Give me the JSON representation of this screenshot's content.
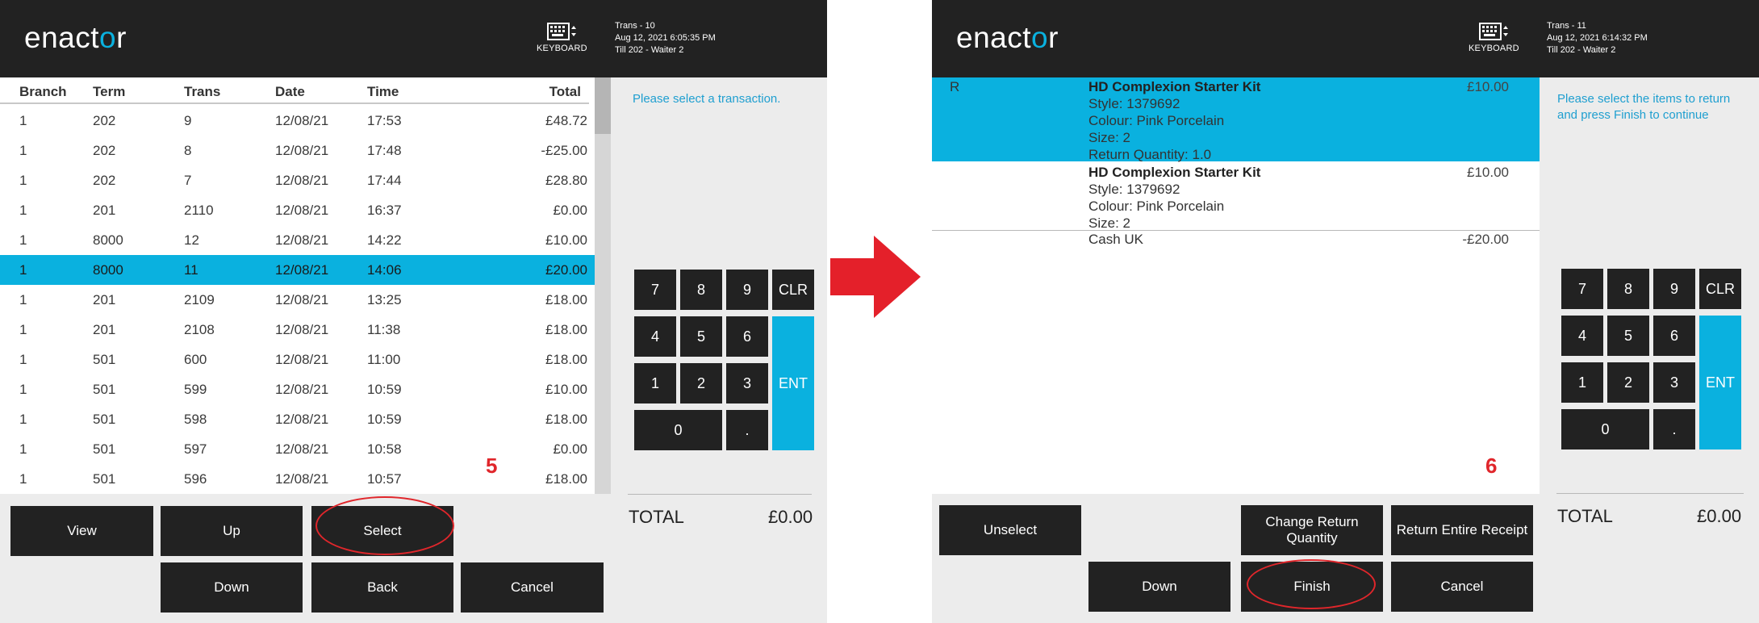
{
  "left": {
    "logo": {
      "pre": "enact",
      "o": "o",
      "post": "r"
    },
    "keyboard_label": "KEYBOARD",
    "info": [
      "Trans - 10",
      "Aug 12, 2021 6:05:35 PM",
      "Till 202 - Waiter 2"
    ],
    "columns": [
      "Branch",
      "Term",
      "Trans",
      "Date",
      "Time",
      "Total"
    ],
    "rows": [
      [
        "1",
        "202",
        "9",
        "12/08/21",
        "17:53",
        "£48.72"
      ],
      [
        "1",
        "202",
        "8",
        "12/08/21",
        "17:48",
        "-£25.00"
      ],
      [
        "1",
        "202",
        "7",
        "12/08/21",
        "17:44",
        "£28.80"
      ],
      [
        "1",
        "201",
        "2110",
        "12/08/21",
        "16:37",
        "£0.00"
      ],
      [
        "1",
        "8000",
        "12",
        "12/08/21",
        "14:22",
        "£10.00"
      ],
      [
        "1",
        "8000",
        "11",
        "12/08/21",
        "14:06",
        "£20.00"
      ],
      [
        "1",
        "201",
        "2109",
        "12/08/21",
        "13:25",
        "£18.00"
      ],
      [
        "1",
        "201",
        "2108",
        "12/08/21",
        "11:38",
        "£18.00"
      ],
      [
        "1",
        "501",
        "600",
        "12/08/21",
        "11:00",
        "£18.00"
      ],
      [
        "1",
        "501",
        "599",
        "12/08/21",
        "10:59",
        "£10.00"
      ],
      [
        "1",
        "501",
        "598",
        "12/08/21",
        "10:59",
        "£18.00"
      ],
      [
        "1",
        "501",
        "597",
        "12/08/21",
        "10:58",
        "£0.00"
      ],
      [
        "1",
        "501",
        "596",
        "12/08/21",
        "10:57",
        "£18.00"
      ]
    ],
    "selected_row": 5,
    "prompt": "Please select a transaction.",
    "step_number": "5",
    "buttons": {
      "view": "View",
      "up": "Up",
      "select": "Select",
      "down": "Down",
      "back": "Back",
      "cancel": "Cancel"
    },
    "total_label": "TOTAL",
    "total_value": "£0.00"
  },
  "right": {
    "logo": {
      "pre": "enact",
      "o": "o",
      "post": "r"
    },
    "keyboard_label": "KEYBOARD",
    "info": [
      "Trans - 11",
      "Aug 12, 2021 6:14:32 PM",
      "Till 202 - Waiter 2"
    ],
    "items": [
      {
        "flag": "R",
        "name": "HD Complexion Starter Kit",
        "price": "£10.00",
        "details": [
          "Style: 1379692",
          "Colour: Pink Porcelain",
          "Size: 2",
          "Return Quantity: 1.0"
        ]
      },
      {
        "flag": "",
        "name": "HD Complexion Starter Kit",
        "price": "£10.00",
        "details": [
          "Style: 1379692",
          "Colour: Pink Porcelain",
          "Size: 2"
        ]
      }
    ],
    "tender": {
      "label": "Cash UK",
      "value": "-£20.00"
    },
    "prompt": [
      "Please select the items to return",
      "and press Finish to continue"
    ],
    "step_number": "6",
    "buttons": {
      "unselect": "Unselect",
      "change_qty": "Change Return Quantity",
      "return_entire": "Return Entire Receipt",
      "down": "Down",
      "finish": "Finish",
      "cancel": "Cancel"
    },
    "total_label": "TOTAL",
    "total_value": "£0.00"
  },
  "keypad": [
    "7",
    "8",
    "9",
    "CLR",
    "4",
    "5",
    "6",
    "ENT",
    "1",
    "2",
    "3",
    "0",
    "."
  ],
  "colors": {
    "accent": "#0ab1df",
    "header": "#222222",
    "highlight_red": "#e0262b",
    "arrow": "#e4202a"
  }
}
